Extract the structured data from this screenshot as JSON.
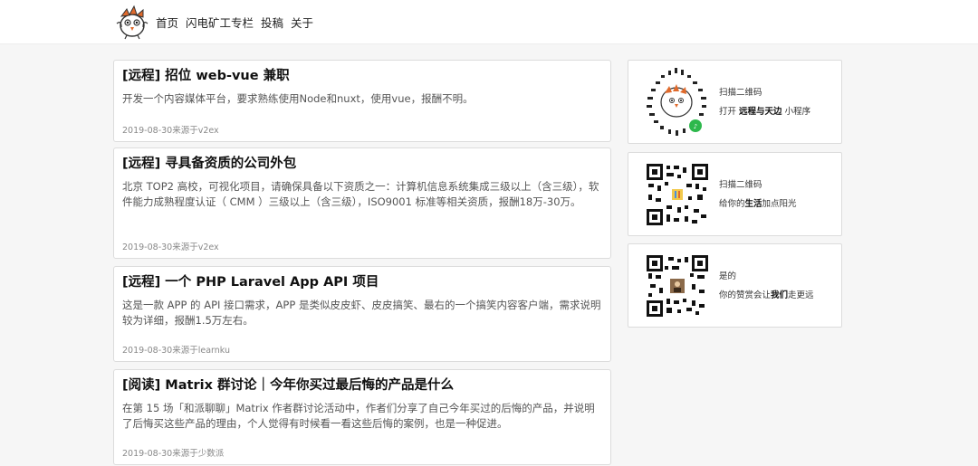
{
  "nav": {
    "items": [
      "首页",
      "闪电矿工专栏",
      "投稿",
      "关于"
    ]
  },
  "posts": [
    {
      "title": "[远程] 招位 web-vue 兼职",
      "desc": "开发一个内容媒体平台，要求熟练使用Node和nuxt，使用vue，报酬不明。",
      "meta": "2019-08-30来源于v2ex"
    },
    {
      "title": "[远程] 寻具备资质的公司外包",
      "desc": "北京 TOP2 高校，可视化项目，请确保具备以下资质之一：计算机信息系统集成三级以上（含三级），软件能力成熟程度认证（ CMM ）三级以上（含三级），ISO9001 标准等相关资质，报酬18万-30万。",
      "meta": "2019-08-30来源于v2ex"
    },
    {
      "title": "[远程] 一个 PHP Laravel App API 项目",
      "desc": "这是一款 APP 的 API 接口需求，APP 是类似皮皮虾、皮皮搞笑、最右的一个搞笑内容客户端，需求说明较为详细，报酬1.5万左右。",
      "meta": "2019-08-30来源于learnku"
    },
    {
      "title": "[阅读] Matrix 群讨论｜今年你买过最后悔的产品是什么",
      "desc": "在第 15 场「和派聊聊」Matrix 作者群讨论活动中，作者们分享了自己今年买过的后悔的产品，并说明了后悔买这些产品的理由，个人觉得有时候看一看这些后悔的案例，也是一种促进。",
      "meta": "2019-08-30来源于少数派"
    }
  ],
  "widgets": [
    {
      "line1": "扫描二维码",
      "line2_pre": "打开 ",
      "line2_bold": "远程与天边",
      "line2_post": " 小程序"
    },
    {
      "line1": "扫描二维码",
      "line2_pre": "给你的",
      "line2_bold": "生活",
      "line2_post": "加点阳光"
    },
    {
      "line1": "是的",
      "line2_pre": "你的赞赏会让",
      "line2_bold": "我们",
      "line2_post": "走更远"
    }
  ],
  "colors": {
    "accent_green": "#2db84c",
    "logo_orange": "#e06a2c"
  },
  "icons": [
    "logo-bird-icon",
    "wechat-miniprogram-qr-icon",
    "qr-code-icon",
    "appreciation-qr-icon"
  ]
}
